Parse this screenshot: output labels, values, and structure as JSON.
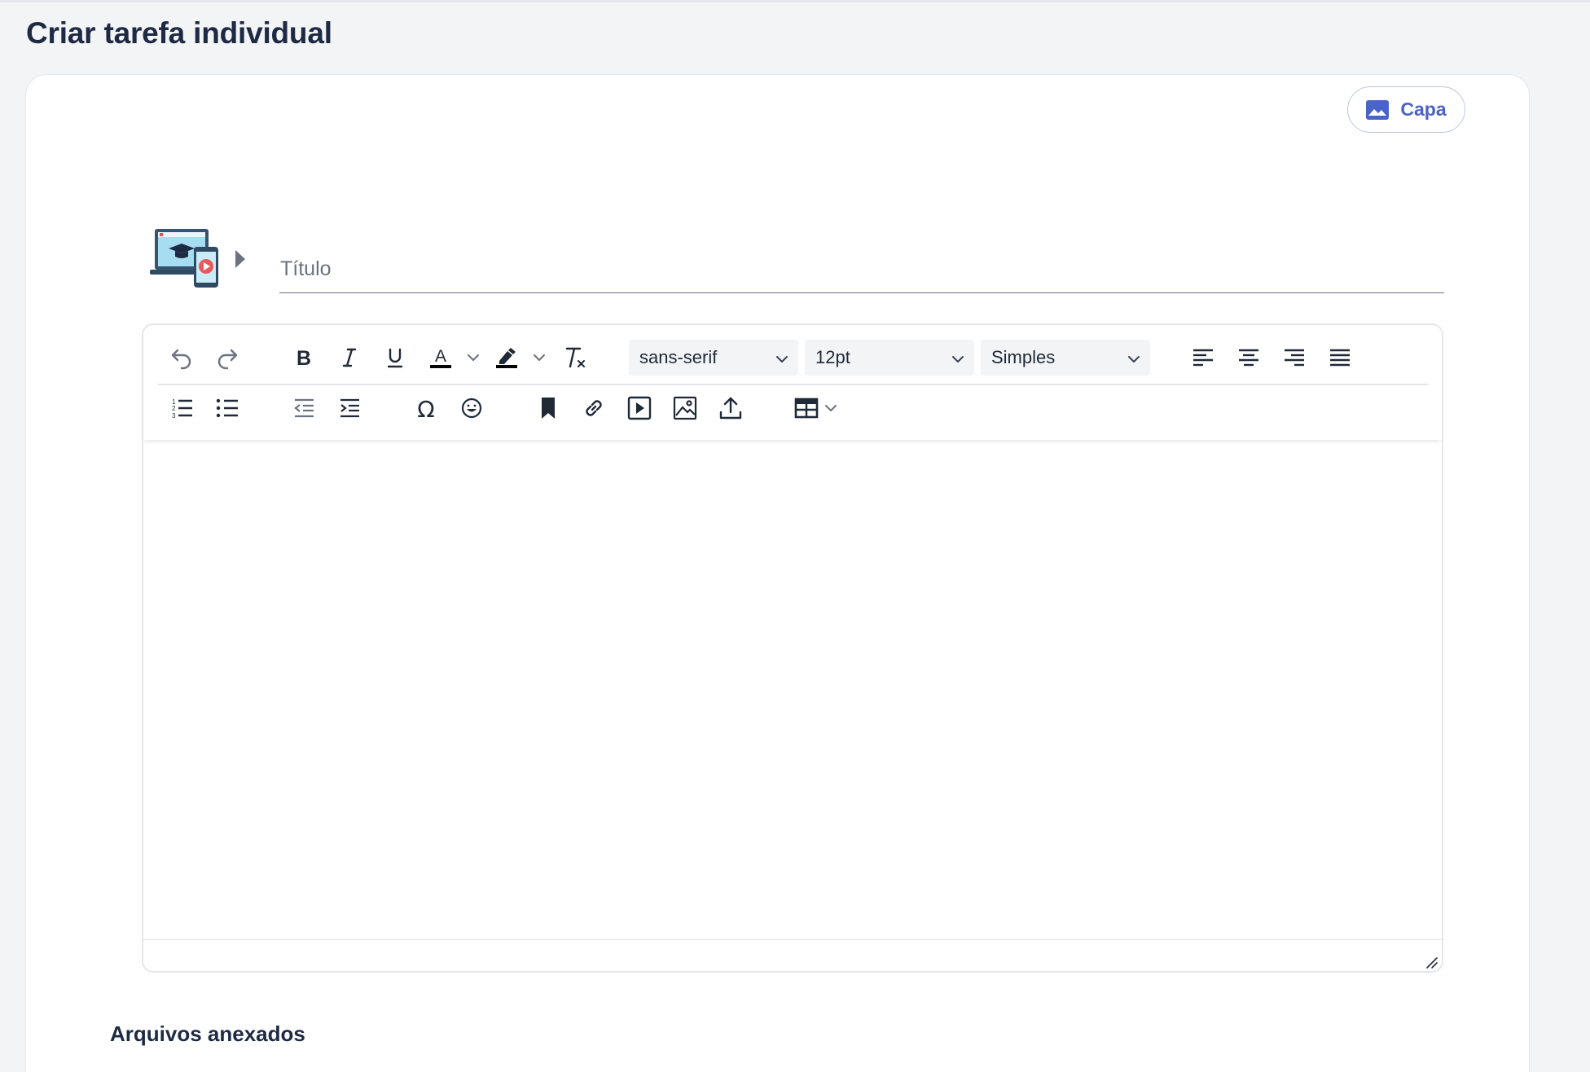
{
  "page": {
    "title": "Criar tarefa individual"
  },
  "cover_button": {
    "label": "Capa",
    "icon": "image-icon",
    "color": "#4a63c8"
  },
  "task": {
    "icon": "online-learning-icon",
    "title_placeholder": "Título",
    "title_value": ""
  },
  "editor": {
    "toolbar_row1": [
      {
        "name": "undo",
        "icon": "undo-icon"
      },
      {
        "name": "redo",
        "icon": "redo-icon"
      },
      {
        "name": "bold",
        "icon": "bold-icon"
      },
      {
        "name": "italic",
        "icon": "italic-icon"
      },
      {
        "name": "underline",
        "icon": "underline-icon"
      },
      {
        "name": "text-color",
        "icon": "text-color-icon"
      },
      {
        "name": "highlight",
        "icon": "highlighter-icon"
      },
      {
        "name": "clear-formatting",
        "icon": "clear-formatting-icon"
      }
    ],
    "font_family": "sans-serif",
    "font_size": "12pt",
    "block_format": "Simples",
    "alignment": [
      "align-left-icon",
      "align-center-icon",
      "align-right-icon",
      "align-justify-icon"
    ],
    "toolbar_row2": [
      "numbered-list-icon",
      "bullet-list-icon",
      "outdent-icon",
      "indent-icon",
      "special-character-icon",
      "emoji-icon",
      "bookmark-icon",
      "link-icon",
      "media-icon",
      "image-icon",
      "upload-icon",
      "table-icon"
    ],
    "content": ""
  },
  "attachments": {
    "title": "Arquivos anexados"
  },
  "colors": {
    "title": "#1e2a44",
    "icon": "#1f2937",
    "disabled_icon": "#6b7280",
    "accent": "#4a63c8"
  }
}
